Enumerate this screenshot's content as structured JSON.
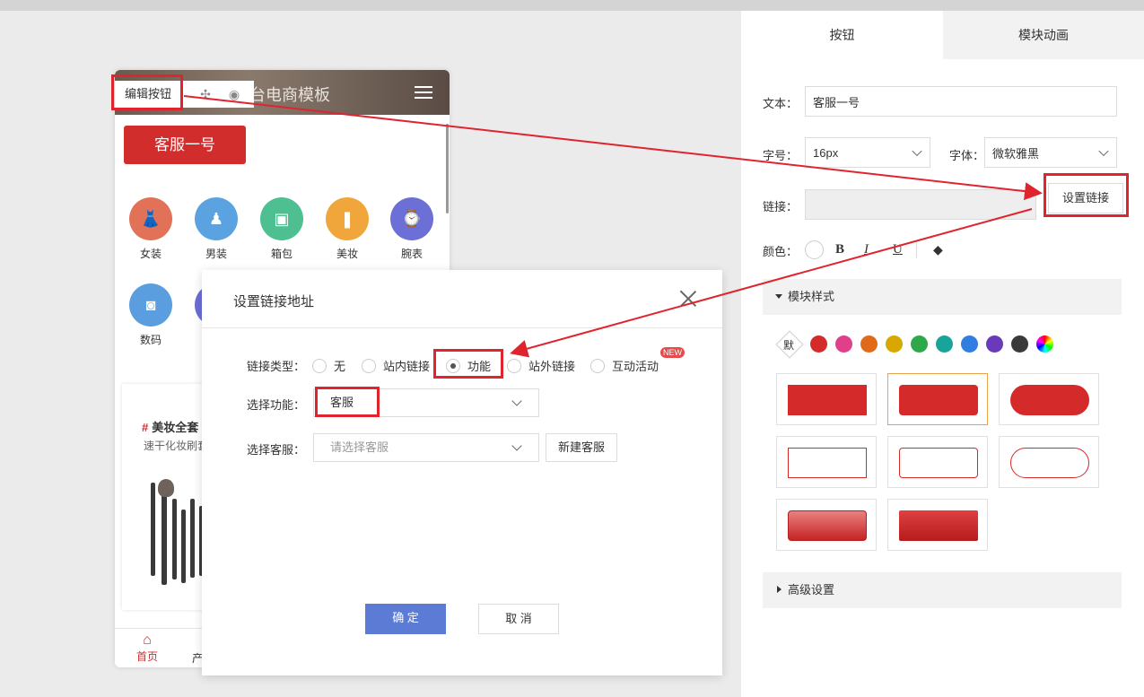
{
  "phone": {
    "title": "台电商模板",
    "toolbar": {
      "edit_label": "编辑按钮"
    },
    "red_button": "客服一号",
    "categories": [
      {
        "label": "女装",
        "color": "#e27257"
      },
      {
        "label": "男装",
        "color": "#5aa3e0"
      },
      {
        "label": "箱包",
        "color": "#4dbf90"
      },
      {
        "label": "美妆",
        "color": "#f0a63a"
      },
      {
        "label": "腕表",
        "color": "#6b6fd6"
      },
      {
        "label": "数码",
        "color": "#5a9ee0"
      }
    ],
    "card": {
      "hash": "#",
      "title": "美妆全套",
      "subtitle": "速干化妆刷套"
    },
    "footer": {
      "home": "首页",
      "product": "产"
    }
  },
  "panel": {
    "tabs": [
      "按钮",
      "模块动画"
    ],
    "text_label": "文本：",
    "text_value": "客服一号",
    "size_label": "字号：",
    "size_value": "16px",
    "font_label": "字体：",
    "font_value": "微软雅黑",
    "link_label": "链接：",
    "set_link": "设置链接",
    "color_label": "颜色：",
    "format": {
      "bold": "B",
      "italic": "I",
      "underline": "U"
    },
    "module_style": "模块样式",
    "default_swatch": "默",
    "swatches": [
      "#d42a2a",
      "#e0408a",
      "#e0691a",
      "#d9a800",
      "#2fa84a",
      "#1aa39a",
      "#2f7ee0",
      "#6a3ab8",
      "#3a3a3a"
    ],
    "advanced": "高级设置"
  },
  "dialog": {
    "title": "设置链接地址",
    "link_type_label": "链接类型：",
    "options": [
      "无",
      "站内链接",
      "功能",
      "站外链接",
      "互动活动"
    ],
    "selected_option": "功能",
    "new_badge": "NEW",
    "function_label": "选择功能：",
    "function_value": "客服",
    "service_label": "选择客服：",
    "service_placeholder": "请选择客服",
    "new_service": "新建客服",
    "confirm": "确 定",
    "cancel": "取 消"
  }
}
